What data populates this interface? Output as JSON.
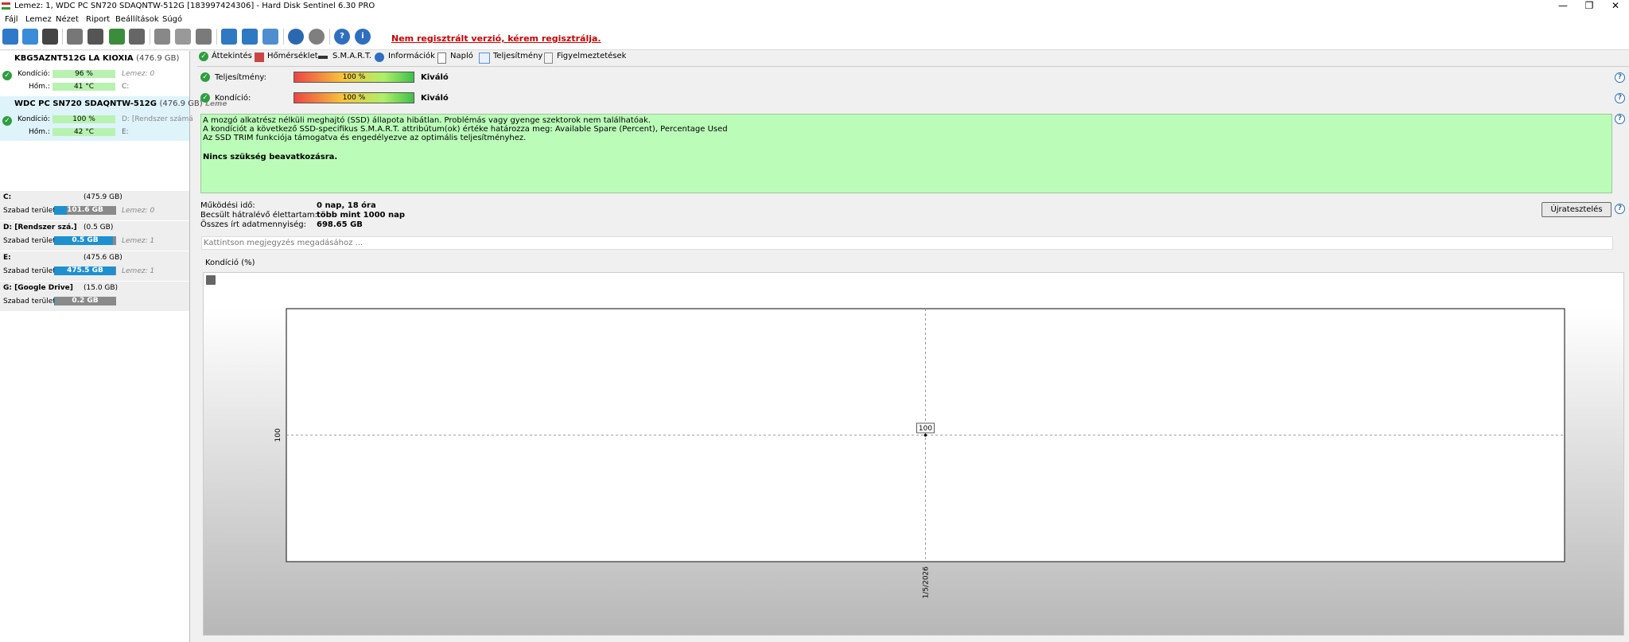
{
  "window": {
    "title": "Lemez: 1, WDC PC SN720 SDAQNTW-512G [183997424306]  -  Hard Disk Sentinel 6.30 PRO",
    "minimize": "—",
    "maximize": "❐",
    "close": "✕"
  },
  "menu": [
    "Fájl",
    "Lemez",
    "Nézet",
    "Riport",
    "Beállítások",
    "Súgó"
  ],
  "toolbar": {
    "icons": [
      "refresh-icon",
      "refresh-all-icon",
      "disk-icon",
      "disk-test-icon",
      "disk-surface-icon",
      "disk-check-icon",
      "disk-repair-icon",
      "hdd-icon",
      "network-icon",
      "drive-icon",
      "report-icon",
      "email-icon",
      "send-icon",
      "settings-icon",
      "tools-icon",
      "help-icon",
      "info-icon"
    ],
    "registration_warning": "Nem regisztrált verzió, kérem regisztrálja."
  },
  "disks": [
    {
      "name": "KBG5AZNT512G LA KIOXIA",
      "size": "(476.9 GB)",
      "condition_label": "Kondíció:",
      "condition": "96 %",
      "condition_value": 96,
      "temp_label": "Hőm.:",
      "temp": "41 °C",
      "disk_ref": "Lemez: 0",
      "drive": "C:"
    },
    {
      "name": "WDC PC SN720 SDAQNTW-512G",
      "size": "(476.9 GB)",
      "ghost": "Leme",
      "condition_label": "Kondíció:",
      "condition": "100 %",
      "condition_value": 100,
      "temp_label": "Hőm.:",
      "temp": "42 °C",
      "disk_ref": "D: [Rendszer számá",
      "drive": "E:"
    }
  ],
  "volumes": [
    {
      "name": "C:",
      "size": "(475.9 GB)",
      "free_label": "Szabad terület",
      "free": "101.6 GB",
      "used_fraction": 0.79,
      "disk": "Lemez: 0"
    },
    {
      "name": "D: [Rendszer szá.]",
      "size": "(0.5 GB)",
      "free_label": "Szabad terület",
      "free": "0.5 GB",
      "used_fraction": 0.05,
      "disk": "Lemez: 1"
    },
    {
      "name": "E:",
      "size": "(475.6 GB)",
      "free_label": "Szabad terület",
      "free": "475.5 GB",
      "used_fraction": 0.01,
      "disk": "Lemez: 1"
    },
    {
      "name": "G: [Google Drive]",
      "size": "(15.0 GB)",
      "free_label": "Szabad terület",
      "free": "0.2 GB",
      "used_fraction": 0.99,
      "disk": ""
    }
  ],
  "tabs": [
    "Áttekintés",
    "Hőmérséklet",
    "S.M.A.R.T.",
    "Információk",
    "Napló",
    "Teljesítmény",
    "Figyelmeztetések"
  ],
  "status": {
    "performance_label": "Teljesítmény:",
    "performance": "100 %",
    "performance_rating": "Kiváló",
    "condition_label": "Kondíció:",
    "condition": "100 %",
    "condition_rating": "Kiváló",
    "help": "?"
  },
  "message": {
    "line1": "A mozgó alkatrész nélküli meghajtó (SSD) állapota hibátlan. Problémás vagy gyenge szektorok nem találhatóak.",
    "line2": "A kondíciót a következő SSD-specifikus S.M.A.R.T. attribútum(ok) értéke határozza meg:  Available Spare (Percent), Percentage Used",
    "line3": "Az SSD TRIM funkciója támogatva és engedélyezve az optimális teljesítményhez.",
    "line4": "Nincs szükség beavatkozásra."
  },
  "info": {
    "uptime_label": "Működési idő:",
    "uptime": "0 nap, 18 óra",
    "remaining_label": "Becsült hátralévő élettartam:",
    "remaining": "több mint 1000 nap",
    "written_label": "Összes írt adatmennyiség:",
    "written": "698.65 GB",
    "retest_button": "Újratesztelés",
    "note_placeholder": "Kattintson megjegyzés megadásához ..."
  },
  "chart_tab": "Kondíció  (%)",
  "chart_data": {
    "type": "line",
    "title": "Kondíció  (%)",
    "x": [
      "1/5/2026"
    ],
    "y": [
      100
    ],
    "point_labels": [
      "100"
    ],
    "ylabel_tick": "100",
    "xlabel_tick": "1/5/2026",
    "grid": true
  },
  "colors": {
    "ok_green": "#2e9e3e",
    "message_bg": "#bbfcb9",
    "warning_red": "#cc0000",
    "free_bar": "#1e90d0"
  }
}
